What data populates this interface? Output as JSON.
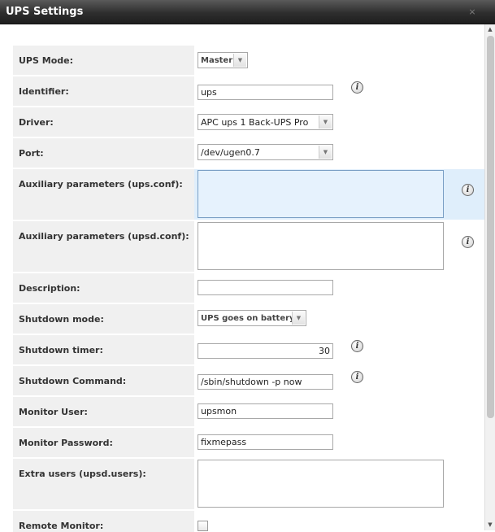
{
  "window": {
    "title": "UPS Settings"
  },
  "form": {
    "ups_mode": {
      "label": "UPS Mode:",
      "value": "Master"
    },
    "identifier": {
      "label": "Identifier:",
      "value": "ups"
    },
    "driver": {
      "label": "Driver:",
      "value": "APC ups 1 Back-UPS Pro"
    },
    "port": {
      "label": "Port:",
      "value": "/dev/ugen0.7"
    },
    "aux_ups_conf": {
      "label": "Auxiliary parameters (ups.conf):",
      "value": ""
    },
    "aux_upsd_conf": {
      "label": "Auxiliary parameters (upsd.conf):",
      "value": ""
    },
    "description": {
      "label": "Description:",
      "value": ""
    },
    "shutdown_mode": {
      "label": "Shutdown mode:",
      "value": "UPS goes on battery"
    },
    "shutdown_timer": {
      "label": "Shutdown timer:",
      "value": "30"
    },
    "shutdown_command": {
      "label": "Shutdown Command:",
      "value": "/sbin/shutdown -p now"
    },
    "monitor_user": {
      "label": "Monitor User:",
      "value": "upsmon"
    },
    "monitor_password": {
      "label": "Monitor Password:",
      "value": "fixmepass"
    },
    "extra_users": {
      "label": "Extra users (upsd.users):",
      "value": ""
    },
    "remote_monitor": {
      "label": "Remote Monitor:",
      "checked": false
    }
  },
  "icons": {
    "info": "i",
    "close": "close-icon"
  },
  "colors": {
    "title_bar": "#2e2e2e",
    "label_bg": "#f0f0f0",
    "focus_highlight": "#dfeefb"
  }
}
